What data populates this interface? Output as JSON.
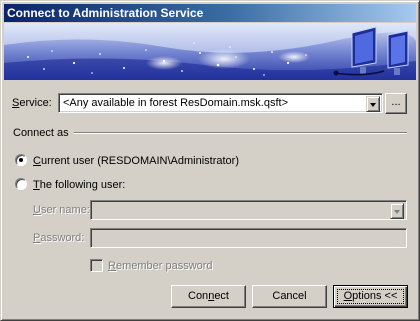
{
  "window": {
    "title": "Connect to Administration Service"
  },
  "service": {
    "label_prefix": "S",
    "label_rest": "ervice:",
    "value": "<Any available in forest ResDomain.msk.qsft>",
    "browse_label": "..."
  },
  "connect_as": {
    "group_label": "Connect as",
    "current_user": {
      "u": "C",
      "rest": "urrent user (RESDOMAIN\\Administrator)",
      "checked": true
    },
    "following_user": {
      "u": "T",
      "rest": "he following user:",
      "checked": false
    }
  },
  "credentials": {
    "username_u": "U",
    "username_rest": "ser name:",
    "username_value": "",
    "password_u": "P",
    "password_rest": "assword:",
    "password_value": "",
    "remember_u": "R",
    "remember_rest": "emember password",
    "remember_checked": false
  },
  "buttons": {
    "connect_pre": "Con",
    "connect_u": "n",
    "connect_post": "ect",
    "cancel": "Cancel",
    "options_u": "O",
    "options_post": "ptions <<"
  },
  "colors": {
    "title_gradient_start": "#0a246a",
    "title_gradient_end": "#a6caf0",
    "face": "#d4d0c8",
    "disabled_text": "#808080"
  },
  "icons": {
    "banner_art": "network-monitor-illustration",
    "combo_arrow": "chevron-down-icon"
  }
}
